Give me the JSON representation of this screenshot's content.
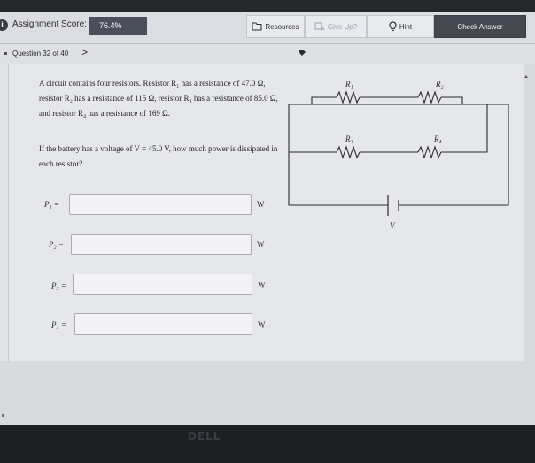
{
  "toolbar": {
    "info_glyph": "i",
    "score_label": "Assignment Score:",
    "score_value": "76.4%",
    "resources_label": "Resources",
    "give_up_label": "Give Up?",
    "hint_label": "Hint",
    "check_answer_label": "Check Answer"
  },
  "nav": {
    "question_label": "Question 32 of 40",
    "next_glyph": ">"
  },
  "problem": {
    "text": "A circuit contains four resistors. Resistor R₁ has a resistance of 47.0 Ω, resistor R₂ has a resistance of 115 Ω, resistor R₃ has a resistance of 85.0 Ω, and resistor R₄ has a resistance of 169 Ω.",
    "question": "If the battery has a voltage of V = 45.0 V, how much power is dissipated in each resistor?"
  },
  "answers": [
    {
      "label": "P₁ =",
      "value": "",
      "unit": "W"
    },
    {
      "label": "P₂ =",
      "value": "",
      "unit": "W"
    },
    {
      "label": "P₃ =",
      "value": "",
      "unit": "W"
    },
    {
      "label": "P₄ =",
      "value": "",
      "unit": "W"
    }
  ],
  "circuit": {
    "r1": "R₁",
    "r2": "R₂",
    "r3": "R₃",
    "r4": "R₄",
    "battery": "V"
  },
  "device_logo": "DELL",
  "colors": {
    "toolbar_bg": "#dcdde2",
    "check_button_bg": "#434851",
    "content_bg": "#e6e7ea"
  }
}
